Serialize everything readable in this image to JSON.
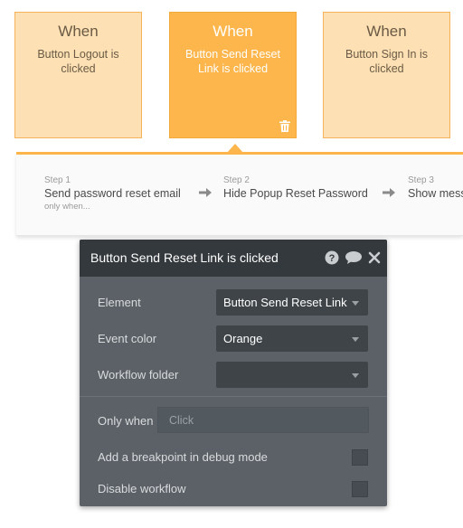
{
  "events": [
    {
      "when": "When",
      "description": "Button Logout is clicked"
    },
    {
      "when": "When",
      "description": "Button Send Reset Link is clicked"
    },
    {
      "when": "When",
      "description": "Button Sign In is clicked"
    }
  ],
  "steps": [
    {
      "number": "Step 1",
      "title": "Send password reset email",
      "condition": "only when..."
    },
    {
      "number": "Step 2",
      "title": "Hide Popup Reset Password"
    },
    {
      "number": "Step 3",
      "title": "Show mess"
    }
  ],
  "props": {
    "title": "Button Send Reset Link is clicked",
    "element_label": "Element",
    "element_value": "Button Send Reset Link",
    "event_color_label": "Event color",
    "event_color_value": "Orange",
    "workflow_folder_label": "Workflow folder",
    "workflow_folder_value": "",
    "only_when_label": "Only when",
    "only_when_placeholder": "Click",
    "breakpoint_label": "Add a breakpoint in debug mode",
    "disable_label": "Disable workflow"
  },
  "colors": {
    "event_card": "#fde1b4",
    "event_card_active": "#fdb64c",
    "panel_bg": "#5b6166",
    "panel_header": "#34393d"
  }
}
